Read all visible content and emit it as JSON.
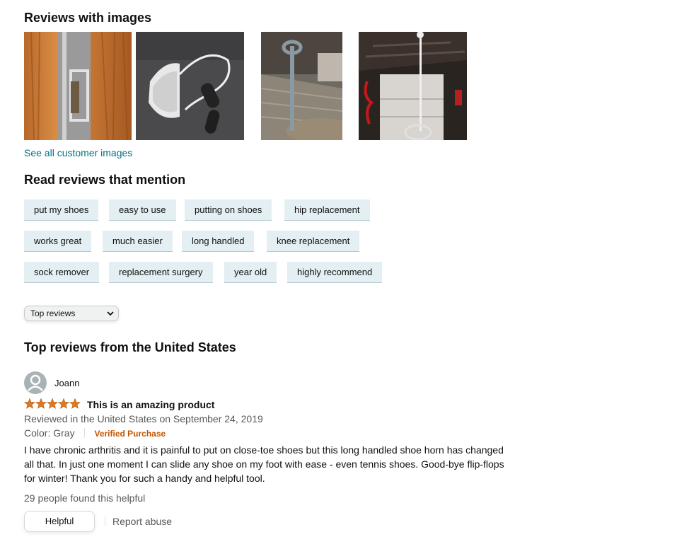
{
  "images_section": {
    "heading": "Reviews with images",
    "see_all_label": "See all customer images"
  },
  "mentions": {
    "heading": "Read reviews that mention",
    "chips": [
      "put my shoes",
      "easy to use",
      "putting on shoes",
      "hip replacement",
      "works great",
      "much easier",
      "long handled",
      "knee replacement",
      "sock remover",
      "replacement surgery",
      "year old",
      "highly recommend"
    ]
  },
  "sort": {
    "selected": "Top reviews"
  },
  "top_reviews": {
    "heading": "Top reviews from the United States"
  },
  "review": {
    "author": "Joann",
    "rating": 5,
    "title": "This is an amazing product",
    "date_line": "Reviewed in the United States on September 24, 2019",
    "color_label": "Color: Gray",
    "verified_label": "Verified Purchase",
    "body": "I have chronic arthritis and it is painful to put on close-toe shoes but this long handled shoe horn has changed all that. In just one moment I can slide any shoe on my foot with ease - even tennis shoes. Good-bye flip-flops for winter! Thank you for such a handy and helpful tool.",
    "helpful_count_text": "29 people found this helpful",
    "helpful_button_label": "Helpful",
    "report_label": "Report abuse"
  },
  "colors": {
    "link": "#007185",
    "chip_bg": "#e3eff2",
    "star": "#de7921",
    "verified": "#c45500"
  }
}
